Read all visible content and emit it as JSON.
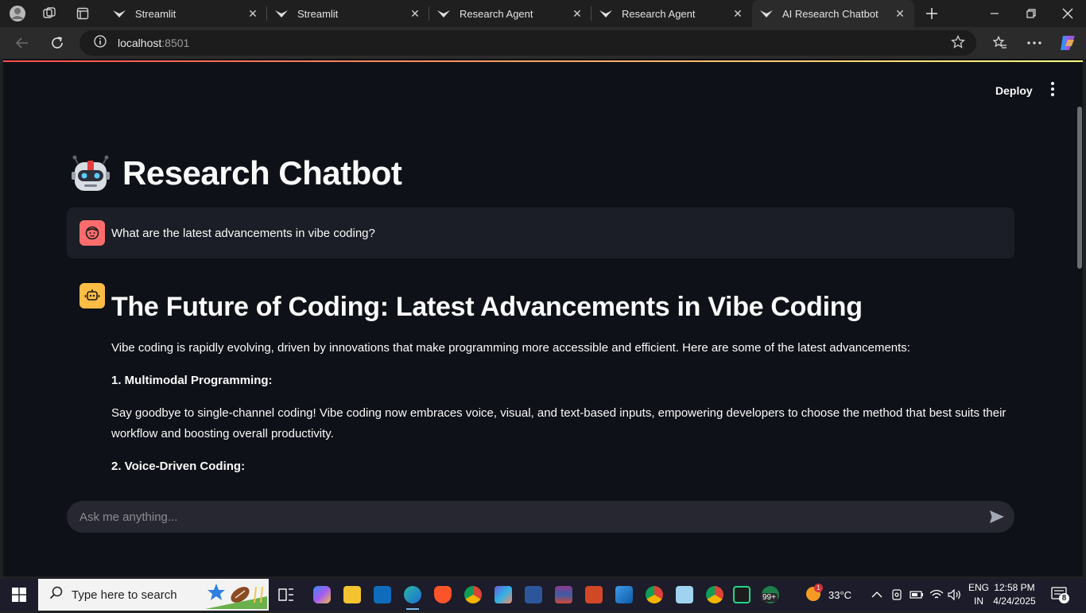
{
  "browser": {
    "tabs": [
      {
        "label": "Streamlit",
        "active": false
      },
      {
        "label": "Streamlit",
        "active": false
      },
      {
        "label": "Research Agent",
        "active": false
      },
      {
        "label": "Research Agent",
        "active": false
      },
      {
        "label": "AI Research Chatbot",
        "active": true
      }
    ],
    "url_host": "localhost",
    "url_port": ":8501"
  },
  "app": {
    "deploy_label": "Deploy",
    "title": "Research Chatbot",
    "user_message": "What are the latest advancements in vibe coding?",
    "assistant": {
      "heading": "The Future of Coding: Latest Advancements in Vibe Coding",
      "intro": "Vibe coding is rapidly evolving, driven by innovations that make programming more accessible and efficient. Here are some of the latest advancements:",
      "item1_title": "1. Multimodal Programming:",
      "item1_body": "Say goodbye to single-channel coding! Vibe coding now embraces voice, visual, and text-based inputs, empowering developers to choose the method that best suits their workflow and boosting overall productivity.",
      "item2_title": "2. Voice-Driven Coding:"
    },
    "chat_placeholder": "Ask me anything..."
  },
  "taskbar": {
    "search_placeholder": "Type here to search",
    "weather": "33°C",
    "lang_line1": "ENG",
    "lang_line2": "IN",
    "time": "12:58 PM",
    "date": "4/24/2025",
    "notification_count": "8",
    "badge_99": "99+",
    "weather_badge": "1"
  },
  "colors": {
    "page_bg": "#0e1117",
    "user_avatar": "#ff6c6c",
    "bot_avatar": "#ffbd45",
    "chat_input_bg": "#262730"
  }
}
